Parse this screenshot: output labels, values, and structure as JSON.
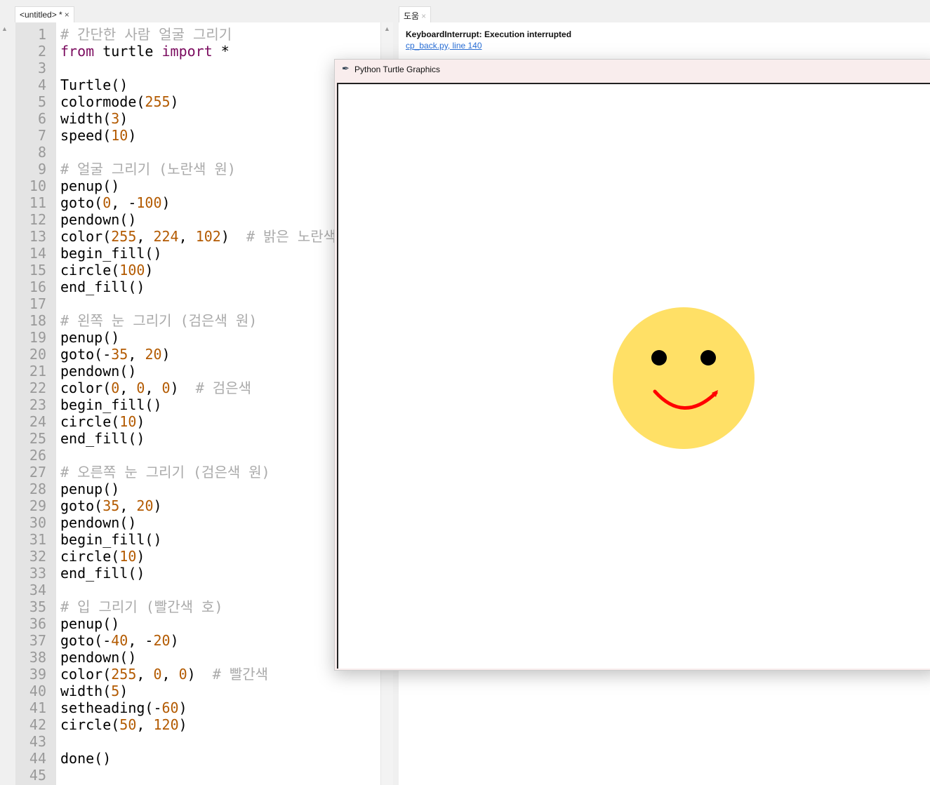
{
  "tabs": {
    "editor": {
      "label": "<untitled> *",
      "close": "×"
    },
    "help": {
      "label": "도움",
      "close": "×"
    }
  },
  "help": {
    "error": "KeyboardInterrupt: Execution interrupted",
    "link": "cp_back.py, line 140"
  },
  "turtle_window": {
    "title": "Python Turtle Graphics",
    "icon": "feather-icon",
    "drawing": {
      "face_color": "#ffe066",
      "eye_color": "#000000",
      "mouth_color": "#ff0000"
    }
  },
  "colors": {
    "keyword": "#7a0a5e",
    "number": "#b35a00",
    "comment": "#aaaaaa"
  },
  "code": [
    [
      [
        "cm",
        "# 간단한 사람 얼굴 그리기"
      ]
    ],
    [
      [
        "kw",
        "from"
      ],
      [
        "pl",
        " turtle "
      ],
      [
        "kw",
        "import"
      ],
      [
        "pl",
        " *"
      ]
    ],
    [],
    [
      [
        "pl",
        "Turtle()"
      ]
    ],
    [
      [
        "pl",
        "colormode("
      ],
      [
        "num",
        "255"
      ],
      [
        "pl",
        ")"
      ]
    ],
    [
      [
        "pl",
        "width("
      ],
      [
        "num",
        "3"
      ],
      [
        "pl",
        ")"
      ]
    ],
    [
      [
        "pl",
        "speed("
      ],
      [
        "num",
        "10"
      ],
      [
        "pl",
        ")"
      ]
    ],
    [],
    [
      [
        "cm",
        "# 얼굴 그리기 (노란색 원)"
      ]
    ],
    [
      [
        "pl",
        "penup()"
      ]
    ],
    [
      [
        "pl",
        "goto("
      ],
      [
        "num",
        "0"
      ],
      [
        "pl",
        ", -"
      ],
      [
        "num",
        "100"
      ],
      [
        "pl",
        ")"
      ]
    ],
    [
      [
        "pl",
        "pendown()"
      ]
    ],
    [
      [
        "pl",
        "color("
      ],
      [
        "num",
        "255"
      ],
      [
        "pl",
        ", "
      ],
      [
        "num",
        "224"
      ],
      [
        "pl",
        ", "
      ],
      [
        "num",
        "102"
      ],
      [
        "pl",
        ")  "
      ],
      [
        "cm",
        "# 밝은 노란색"
      ]
    ],
    [
      [
        "pl",
        "begin_fill()"
      ]
    ],
    [
      [
        "pl",
        "circle("
      ],
      [
        "num",
        "100"
      ],
      [
        "pl",
        ")"
      ]
    ],
    [
      [
        "pl",
        "end_fill()"
      ]
    ],
    [],
    [
      [
        "cm",
        "# 왼쪽 눈 그리기 (검은색 원)"
      ]
    ],
    [
      [
        "pl",
        "penup()"
      ]
    ],
    [
      [
        "pl",
        "goto(-"
      ],
      [
        "num",
        "35"
      ],
      [
        "pl",
        ", "
      ],
      [
        "num",
        "20"
      ],
      [
        "pl",
        ")"
      ]
    ],
    [
      [
        "pl",
        "pendown()"
      ]
    ],
    [
      [
        "pl",
        "color("
      ],
      [
        "num",
        "0"
      ],
      [
        "pl",
        ", "
      ],
      [
        "num",
        "0"
      ],
      [
        "pl",
        ", "
      ],
      [
        "num",
        "0"
      ],
      [
        "pl",
        ")  "
      ],
      [
        "cm",
        "# 검은색"
      ]
    ],
    [
      [
        "pl",
        "begin_fill()"
      ]
    ],
    [
      [
        "pl",
        "circle("
      ],
      [
        "num",
        "10"
      ],
      [
        "pl",
        ")"
      ]
    ],
    [
      [
        "pl",
        "end_fill()"
      ]
    ],
    [],
    [
      [
        "cm",
        "# 오른쪽 눈 그리기 (검은색 원)"
      ]
    ],
    [
      [
        "pl",
        "penup()"
      ]
    ],
    [
      [
        "pl",
        "goto("
      ],
      [
        "num",
        "35"
      ],
      [
        "pl",
        ", "
      ],
      [
        "num",
        "20"
      ],
      [
        "pl",
        ")"
      ]
    ],
    [
      [
        "pl",
        "pendown()"
      ]
    ],
    [
      [
        "pl",
        "begin_fill()"
      ]
    ],
    [
      [
        "pl",
        "circle("
      ],
      [
        "num",
        "10"
      ],
      [
        "pl",
        ")"
      ]
    ],
    [
      [
        "pl",
        "end_fill()"
      ]
    ],
    [],
    [
      [
        "cm",
        "# 입 그리기 (빨간색 호)"
      ]
    ],
    [
      [
        "pl",
        "penup()"
      ]
    ],
    [
      [
        "pl",
        "goto(-"
      ],
      [
        "num",
        "40"
      ],
      [
        "pl",
        ", -"
      ],
      [
        "num",
        "20"
      ],
      [
        "pl",
        ")"
      ]
    ],
    [
      [
        "pl",
        "pendown()"
      ]
    ],
    [
      [
        "pl",
        "color("
      ],
      [
        "num",
        "255"
      ],
      [
        "pl",
        ", "
      ],
      [
        "num",
        "0"
      ],
      [
        "pl",
        ", "
      ],
      [
        "num",
        "0"
      ],
      [
        "pl",
        ")  "
      ],
      [
        "cm",
        "# 빨간색"
      ]
    ],
    [
      [
        "pl",
        "width("
      ],
      [
        "num",
        "5"
      ],
      [
        "pl",
        ")"
      ]
    ],
    [
      [
        "pl",
        "setheading(-"
      ],
      [
        "num",
        "60"
      ],
      [
        "pl",
        ")"
      ]
    ],
    [
      [
        "pl",
        "circle("
      ],
      [
        "num",
        "50"
      ],
      [
        "pl",
        ", "
      ],
      [
        "num",
        "120"
      ],
      [
        "pl",
        ")"
      ]
    ],
    [],
    [
      [
        "pl",
        "done()"
      ]
    ],
    []
  ]
}
